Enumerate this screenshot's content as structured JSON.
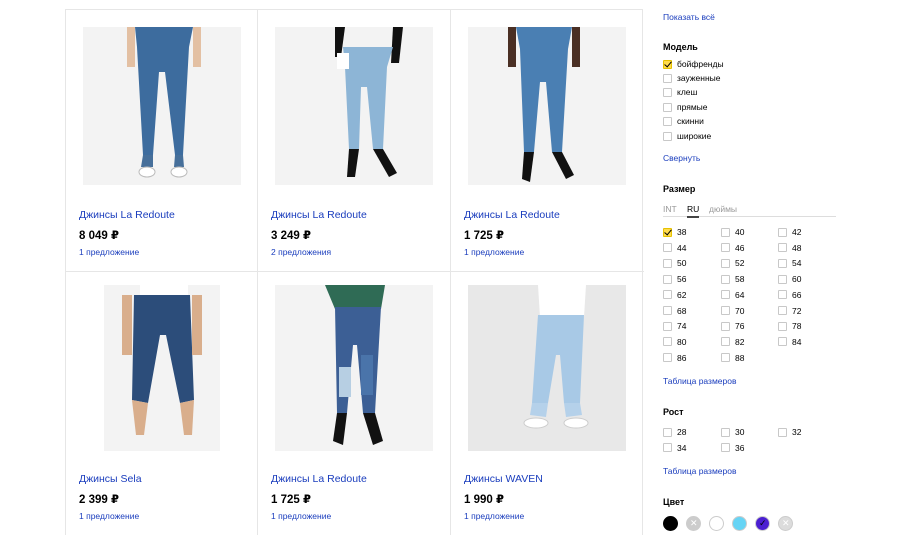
{
  "products": [
    {
      "title": "Джинсы La Redoute",
      "price": "8 049 ₽",
      "offers": "1 предложение"
    },
    {
      "title": "Джинсы La Redoute",
      "price": "3 249 ₽",
      "offers": "2 предложения"
    },
    {
      "title": "Джинсы La Redoute",
      "price": "1 725 ₽",
      "offers": "1 предложение"
    },
    {
      "title": "Джинсы Sela",
      "price": "2 399 ₽",
      "offers": "1 предложение"
    },
    {
      "title": "Джинсы La Redoute",
      "price": "1 725 ₽",
      "offers": "1 предложение"
    },
    {
      "title": "Джинсы WAVEN",
      "price": "1 990 ₽",
      "offers": "1 предложение"
    }
  ],
  "sidebar": {
    "show_all": "Показать всё",
    "model": {
      "heading": "Модель",
      "options": [
        {
          "label": "бойфренды",
          "checked": true
        },
        {
          "label": "зауженные",
          "checked": false
        },
        {
          "label": "клеш",
          "checked": false
        },
        {
          "label": "прямые",
          "checked": false
        },
        {
          "label": "скинни",
          "checked": false
        },
        {
          "label": "широкие",
          "checked": false
        }
      ],
      "collapse": "Свернуть"
    },
    "size": {
      "heading": "Размер",
      "tabs": [
        "INT",
        "RU",
        "дюймы"
      ],
      "active_tab": "RU",
      "options": [
        "38",
        "40",
        "42",
        "44",
        "46",
        "48",
        "50",
        "52",
        "54",
        "56",
        "58",
        "60",
        "62",
        "64",
        "66",
        "68",
        "70",
        "72",
        "74",
        "76",
        "78",
        "80",
        "82",
        "84",
        "86",
        "88"
      ],
      "checked": [
        "38"
      ],
      "table_link": "Таблица размеров"
    },
    "height": {
      "heading": "Рост",
      "options": [
        "28",
        "30",
        "32",
        "34",
        "36"
      ],
      "table_link": "Таблица размеров"
    },
    "color": {
      "heading": "Цвет",
      "swatches": [
        {
          "name": "black",
          "hex": "#000000"
        },
        {
          "name": "gray",
          "hex": "#cccccc"
        },
        {
          "name": "white",
          "hex": "#ffffff"
        },
        {
          "name": "light-blue",
          "hex": "#66d4f5"
        },
        {
          "name": "purple",
          "hex": "#4b1fd1"
        },
        {
          "name": "silver",
          "hex": "#dcdcdc"
        }
      ]
    }
  }
}
